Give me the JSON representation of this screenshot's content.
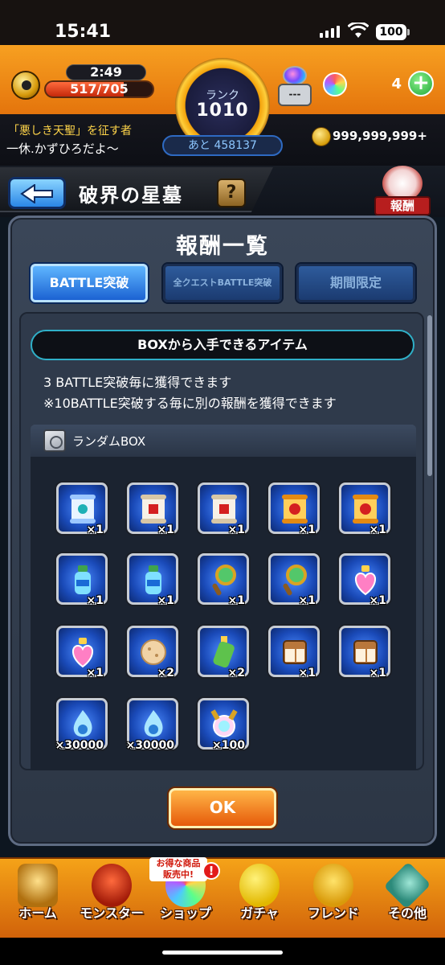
{
  "status_bar": {
    "time": "15:41",
    "battery": "100"
  },
  "header": {
    "stamina_timer": "2:49",
    "stamina": "517/705",
    "stamina_fraction": 0.733,
    "rank_label": "ランク",
    "rank": "1010",
    "rank_next": "あと 458137",
    "luck_box_label": "---",
    "orbs": "4",
    "title": "「悪しき天聖」を征す者",
    "user_name": "一休.かずひろだよ～",
    "coins": "999,999,999+"
  },
  "quest": {
    "name": "破界の星墓",
    "help": "?",
    "reward_badge": "報酬"
  },
  "modal": {
    "title": "報酬一覧",
    "tabs": [
      {
        "label": "BATTLE突破",
        "active": true
      },
      {
        "label": "全クエストBATTLE突破",
        "active": false
      },
      {
        "label": "期間限定",
        "active": false
      }
    ],
    "section_label": "BOXから入手できるアイテム",
    "desc1": "3 BATTLE突破毎に獲得できます",
    "desc2": "※10BATTLE突破する毎に別の報酬を獲得できます",
    "box_name": "ランダムBOX",
    "items": [
      {
        "icon": "scroll-blue-icon",
        "qty": "×1"
      },
      {
        "icon": "scroll-red-icon",
        "qty": "×1"
      },
      {
        "icon": "scroll-red-icon",
        "qty": "×1"
      },
      {
        "icon": "scroll-gold-icon",
        "qty": "×1"
      },
      {
        "icon": "scroll-gold-icon",
        "qty": "×1"
      },
      {
        "icon": "potion-bottle-icon",
        "qty": "×1"
      },
      {
        "icon": "potion-bottle-icon",
        "qty": "×1"
      },
      {
        "icon": "magnifier-icon",
        "qty": "×1"
      },
      {
        "icon": "magnifier-icon",
        "qty": "×1"
      },
      {
        "icon": "heart-potion-icon",
        "qty": "×1"
      },
      {
        "icon": "heart-potion-icon",
        "qty": "×1"
      },
      {
        "icon": "cookie-icon",
        "qty": "×2"
      },
      {
        "icon": "green-bottle-icon",
        "qty": "×2"
      },
      {
        "icon": "dice-icon",
        "qty": "×1"
      },
      {
        "icon": "dice-icon",
        "qty": "×1"
      },
      {
        "icon": "blue-flame-icon",
        "qty": "×30000"
      },
      {
        "icon": "blue-flame-icon",
        "qty": "×30000"
      },
      {
        "icon": "rainbow-orb-icon",
        "qty": "×100"
      }
    ],
    "ok_label": "OK"
  },
  "nav": {
    "items": [
      {
        "label": "ホーム",
        "icon": "home-icon"
      },
      {
        "label": "モンスター",
        "icon": "monster-icon"
      },
      {
        "label": "ショップ",
        "icon": "shop-orb-icon"
      },
      {
        "label": "ガチャ",
        "icon": "gacha-egg-icon"
      },
      {
        "label": "フレンド",
        "icon": "friend-icon"
      },
      {
        "label": "その他",
        "icon": "other-icon"
      }
    ],
    "sale_tag": "お得な商品\n販売中!",
    "sale_bang": "!"
  },
  "colors": {
    "accent_orange": "#f5a318",
    "tab_active": "#1b62d2",
    "ok_button": "#e65a0a"
  }
}
